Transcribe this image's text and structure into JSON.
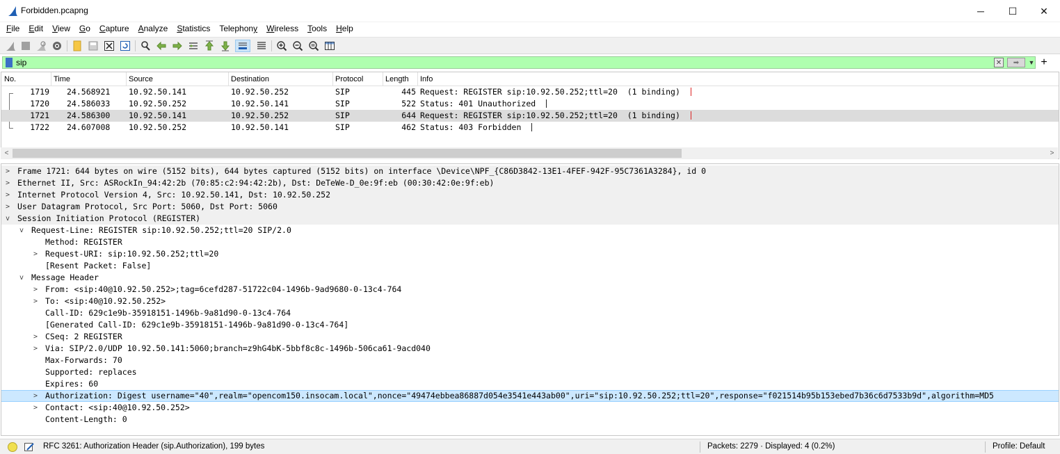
{
  "window": {
    "title": "Forbidden.pcapng",
    "min_glyph": "─",
    "max_glyph": "☐",
    "close_glyph": "✕"
  },
  "menu": [
    {
      "u": "F",
      "rest": "ile"
    },
    {
      "u": "E",
      "rest": "dit"
    },
    {
      "u": "V",
      "rest": "iew"
    },
    {
      "u": "G",
      "rest": "o"
    },
    {
      "u": "C",
      "rest": "apture"
    },
    {
      "u": "A",
      "rest": "nalyze"
    },
    {
      "u": "S",
      "rest": "tatistics"
    },
    {
      "u": "",
      "rest": "Telephon",
      "u2": "y"
    },
    {
      "u": "W",
      "rest": "ireless"
    },
    {
      "u": "T",
      "rest": "ools"
    },
    {
      "u": "H",
      "rest": "elp"
    }
  ],
  "filter": {
    "value": "sip",
    "apply_glyph": "➡",
    "clear_glyph": "✕",
    "dropdown_glyph": "▼",
    "add_glyph": "+"
  },
  "packet_list": {
    "columns": [
      "No.",
      "Time",
      "Source",
      "Destination",
      "Protocol",
      "Length",
      "Info"
    ],
    "rows": [
      {
        "no": "1719",
        "time": "24.568921",
        "src": "10.92.50.141",
        "dst": "10.92.50.252",
        "proto": "SIP",
        "len": "445",
        "info": "Request: REGISTER sip:10.92.50.252;ttl=20  (1 binding) "
      },
      {
        "no": "1720",
        "time": "24.586033",
        "src": "10.92.50.252",
        "dst": "10.92.50.141",
        "proto": "SIP",
        "len": "522",
        "info": "Status: 401 Unauthorized "
      },
      {
        "no": "1721",
        "time": "24.586300",
        "src": "10.92.50.141",
        "dst": "10.92.50.252",
        "proto": "SIP",
        "len": "644",
        "info": "Request: REGISTER sip:10.92.50.252;ttl=20  (1 binding) "
      },
      {
        "no": "1722",
        "time": "24.607008",
        "src": "10.92.50.252",
        "dst": "10.92.50.141",
        "proto": "SIP",
        "len": "462",
        "info": "Status: 403 Forbidden "
      }
    ]
  },
  "scroll": {
    "left": "<",
    "right": ">"
  },
  "details": {
    "rows": [
      {
        "chev": ">",
        "text": "Frame 1721: 644 bytes on wire (5152 bits), 644 bytes captured (5152 bits) on interface \\Device\\NPF_{C86D3842-13E1-4FEF-942F-95C7361A3284}, id 0"
      },
      {
        "chev": ">",
        "text": "Ethernet II, Src: ASRockIn_94:42:2b (70:85:c2:94:42:2b), Dst: DeTeWe-D_0e:9f:eb (00:30:42:0e:9f:eb)"
      },
      {
        "chev": ">",
        "text": "Internet Protocol Version 4, Src: 10.92.50.141, Dst: 10.92.50.252"
      },
      {
        "chev": ">",
        "text": "User Datagram Protocol, Src Port: 5060, Dst Port: 5060"
      },
      {
        "chev": "v",
        "text": "Session Initiation Protocol (REGISTER)"
      },
      {
        "chev": "v",
        "text": "Request-Line: REGISTER sip:10.92.50.252;ttl=20 SIP/2.0"
      },
      {
        "chev": "",
        "text": "Method: REGISTER"
      },
      {
        "chev": ">",
        "text": "Request-URI: sip:10.92.50.252;ttl=20"
      },
      {
        "chev": "",
        "text": "[Resent Packet: False]"
      },
      {
        "chev": "v",
        "text": "Message Header"
      },
      {
        "chev": ">",
        "text": "From: <sip:40@10.92.50.252>;tag=6cefd287-51722c04-1496b-9ad9680-0-13c4-764"
      },
      {
        "chev": ">",
        "text": "To: <sip:40@10.92.50.252>"
      },
      {
        "chev": "",
        "text": "Call-ID: 629c1e9b-35918151-1496b-9a81d90-0-13c4-764"
      },
      {
        "chev": "",
        "text": "[Generated Call-ID: 629c1e9b-35918151-1496b-9a81d90-0-13c4-764]"
      },
      {
        "chev": ">",
        "text": "CSeq: 2 REGISTER"
      },
      {
        "chev": ">",
        "text": "Via: SIP/2.0/UDP 10.92.50.141:5060;branch=z9hG4bK-5bbf8c8c-1496b-506ca61-9acd040"
      },
      {
        "chev": "",
        "text": "Max-Forwards: 70"
      },
      {
        "chev": "",
        "text": "Supported: replaces"
      },
      {
        "chev": "",
        "text": "Expires: 60"
      },
      {
        "chev": ">",
        "text": "Authorization: Digest username=\"40\",realm=\"opencom150.insocam.local\",nonce=\"49474ebbea86887d054e3541e443ab00\",uri=\"sip:10.92.50.252;ttl=20\",response=\"f021514b95b153ebed7b36c6d7533b9d\",algorithm=MD5"
      },
      {
        "chev": ">",
        "text": "Contact: <sip:40@10.92.50.252>"
      },
      {
        "chev": "",
        "text": "Content-Length: 0"
      }
    ]
  },
  "status": {
    "field_info": "RFC 3261: Authorization Header (sip.Authorization), 199 bytes",
    "packets": "Packets: 2279 · Displayed: 4 (0.2%)",
    "profile": "Profile: Default"
  },
  "icons": {
    "app": "wireshark-fin-icon",
    "colors": {
      "filter_bg": "#afffaf",
      "selected_row": "#dcdcdc",
      "highlight": "#cce8ff",
      "bookmark": "#3c6fc6"
    }
  }
}
